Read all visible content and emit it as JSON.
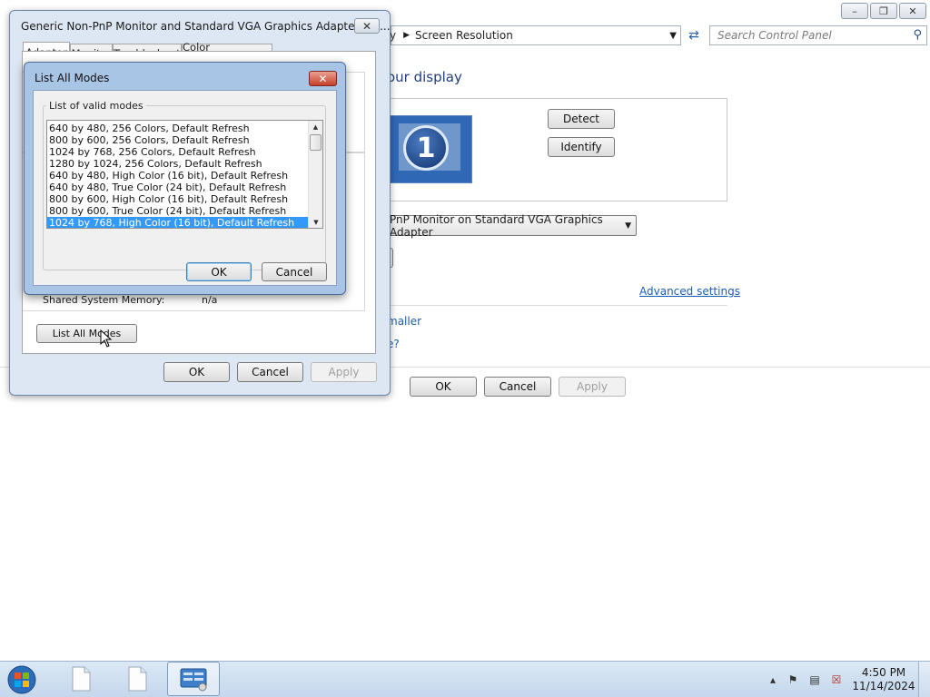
{
  "control_panel": {
    "breadcrumb_fragment": "y",
    "breadcrumb_current": "Screen Resolution",
    "search_placeholder": "Search Control Panel",
    "heading_fragment": "our display",
    "monitor_number": "1",
    "detect_label": "Detect",
    "identify_label": "Identify",
    "display_select_value": "PnP Monitor on Standard VGA Graphics Adapter",
    "advanced_settings_link": "Advanced settings",
    "link_fragment_1": "maller",
    "link_fragment_2": "e?",
    "ok_label": "OK",
    "cancel_label": "Cancel",
    "apply_label": "Apply"
  },
  "properties_dialog": {
    "title": "Generic Non-PnP Monitor and Standard VGA Graphics Adapter Pro...",
    "tabs": [
      "Adapter",
      "Monitor",
      "Troubleshoot",
      "Color Management"
    ],
    "shared_memory_label": "Shared System Memory:",
    "shared_memory_value": "n/a",
    "list_all_modes_label": "List All Modes",
    "ok_label": "OK",
    "cancel_label": "Cancel",
    "apply_label": "Apply"
  },
  "modes_dialog": {
    "title": "List All Modes",
    "group_label": "List of valid modes",
    "modes": [
      "640 by 480, 256 Colors, Default Refresh",
      "800 by 600, 256 Colors, Default Refresh",
      "1024 by 768, 256 Colors, Default Refresh",
      "1280 by 1024, 256 Colors, Default Refresh",
      "640 by 480, High Color (16 bit), Default Refresh",
      "640 by 480, True Color (24 bit), Default Refresh",
      "800 by 600, High Color (16 bit), Default Refresh",
      "800 by 600, True Color (24 bit), Default Refresh",
      "1024 by 768, High Color (16 bit), Default Refresh"
    ],
    "selected_mode": "1024 by 768, High Color (16 bit), Default Refresh",
    "ok_label": "OK",
    "cancel_label": "Cancel"
  },
  "taskbar": {
    "time": "4:50 PM",
    "date": "11/14/2024"
  },
  "colors": {
    "selection": "#3399ff",
    "link": "#1a5fb4",
    "taskbar": "#c5d7ec"
  }
}
